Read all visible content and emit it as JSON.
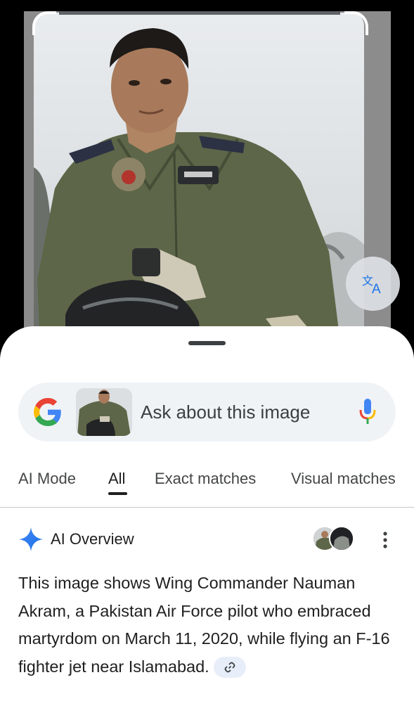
{
  "search": {
    "placeholder": "Ask about this image"
  },
  "tabs": [
    {
      "label": "AI Mode"
    },
    {
      "label": "All",
      "active": true
    },
    {
      "label": "Exact matches"
    },
    {
      "label": "Visual matches"
    }
  ],
  "ai_overview": {
    "title": "AI Overview",
    "text": "This image shows Wing Commander Nauman Akram, a Pakistan Air Force pilot who embraced martyrdom on March 11, 2020, while flying an F-16 fighter jet near Islamabad."
  },
  "icons": {
    "translate": "translate-icon",
    "google": "google-g-logo",
    "mic": "mic-icon",
    "sparkle": "sparkle-icon",
    "more": "more-vert-icon",
    "link": "link-icon"
  },
  "colors": {
    "sheet_bg": "#ffffff",
    "pill_bg": "#f0f3f6",
    "google_blue": "#4285f4",
    "google_red": "#ea4335",
    "google_yellow": "#fbbc05",
    "google_green": "#34a853"
  }
}
